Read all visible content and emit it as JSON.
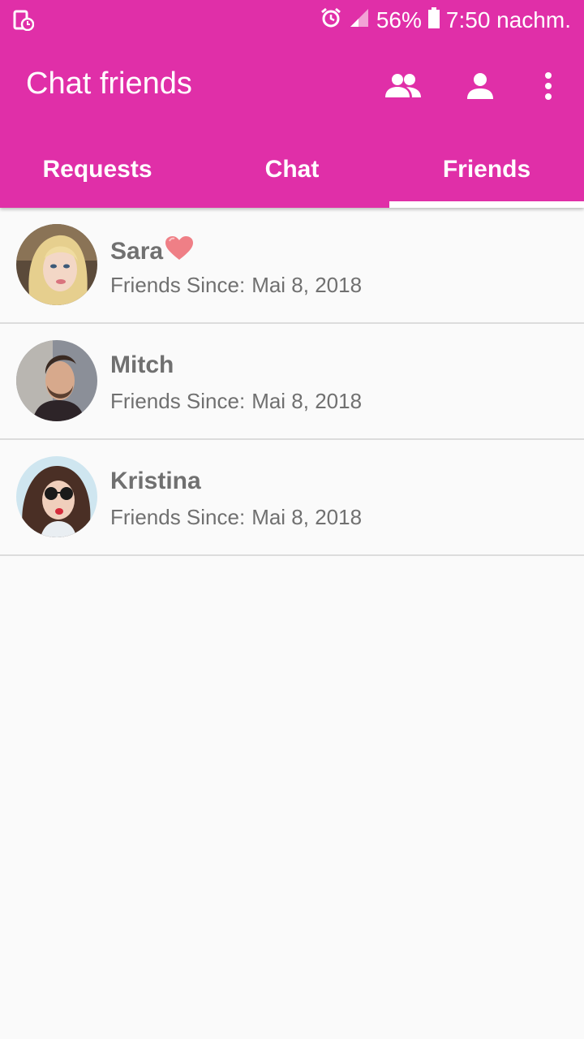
{
  "status_bar": {
    "battery": "56%",
    "time": "7:50 nachm."
  },
  "app_bar": {
    "title": "Chat friends",
    "icons": [
      "people-icon",
      "person-icon",
      "more-vert-icon"
    ]
  },
  "tabs": [
    {
      "label": "Requests",
      "active": false
    },
    {
      "label": "Chat",
      "active": false
    },
    {
      "label": "Friends",
      "active": true
    }
  ],
  "friends": [
    {
      "name": "Sara",
      "emoji": "heart",
      "since_label": "Friends Since:",
      "since_date": "Mai 8, 2018"
    },
    {
      "name": "Mitch",
      "since_label": "Friends Since:",
      "since_date": "Mai 8, 2018"
    },
    {
      "name": "Kristina",
      "since_label": "Friends Since:",
      "since_date": "Mai 8, 2018"
    }
  ],
  "colors": {
    "primary": "#e02fa8",
    "text_secondary": "#707070",
    "background": "#fafafa"
  }
}
